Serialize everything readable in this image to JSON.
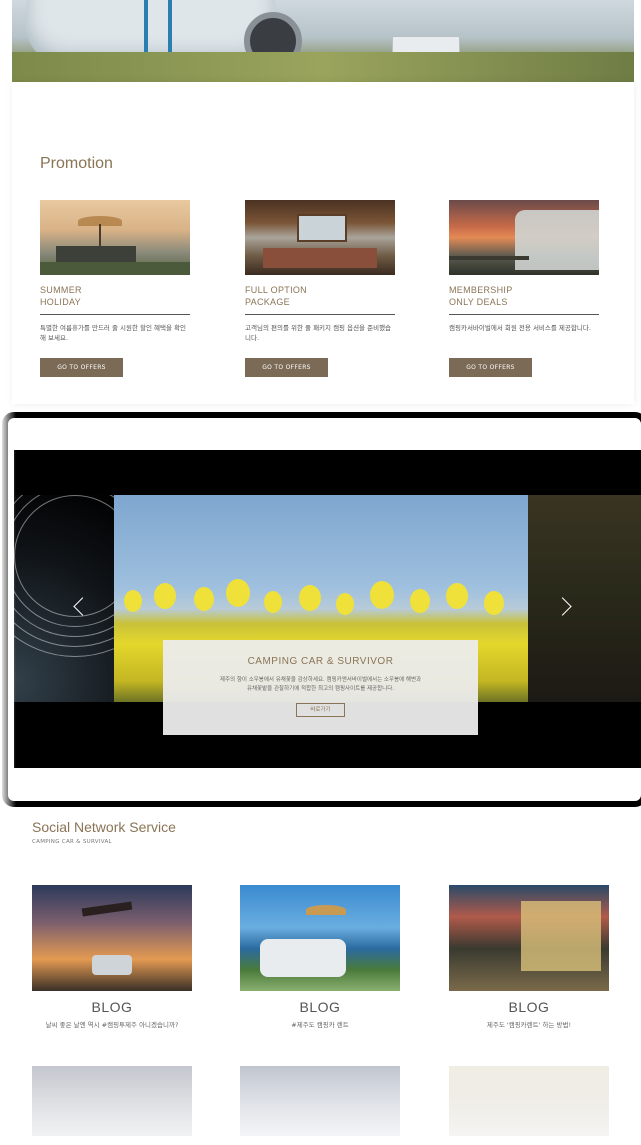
{
  "colors": {
    "accent": "#8a7456",
    "button": "#7b6a55"
  },
  "promotion": {
    "title": "Promotion",
    "cards": [
      {
        "title_line1": "SUMMER",
        "title_line2": "HOLIDAY",
        "desc": "특별한 여름휴가를 만드러 줄 시원한 할인 혜택을 확인해 보세요.",
        "button": "GO TO OFFERS"
      },
      {
        "title_line1": "FULL OPTION",
        "title_line2": "PACKAGE",
        "desc": "고객님의 편의를 위한 풀 패키지 캠핑 옵션을 준비했습니다.",
        "button": "GO TO OFFERS"
      },
      {
        "title_line1": "MEMBERSHIP",
        "title_line2": "ONLY DEALS",
        "desc": "캠핑카서바이벌에서 회원 전용 서비스를 제공합니다.",
        "button": "GO TO OFFERS"
      }
    ]
  },
  "slider": {
    "title": "CAMPING CAR & SURVIVOR",
    "text_line1": "제주의 향이 소우봉에서 유채꽃을 감상하세요. 캠핑카앤서바이벌에서는 소우봉에 해변과",
    "text_line2": "유채꽃밭을 관찰하기에 적합한 최고의 캠핑사이트를 제공합니다.",
    "button": "바로가기",
    "prev_icon": "chevron-left-icon",
    "next_icon": "chevron-right-icon"
  },
  "sns": {
    "title": "Social Network Service",
    "subtitle": "CAMPING CAR & SURVIVAL",
    "posts": [
      {
        "title": "BLOG",
        "desc": "날씨 좋은 날엔 역시 #캠핑투제주 아니겠습니까?"
      },
      {
        "title": "BLOG",
        "desc": "#제주도 캠핑카 렌트"
      },
      {
        "title": "BLOG",
        "desc": "제주도 '캠핑카렌트' 하는 방법!"
      }
    ]
  }
}
